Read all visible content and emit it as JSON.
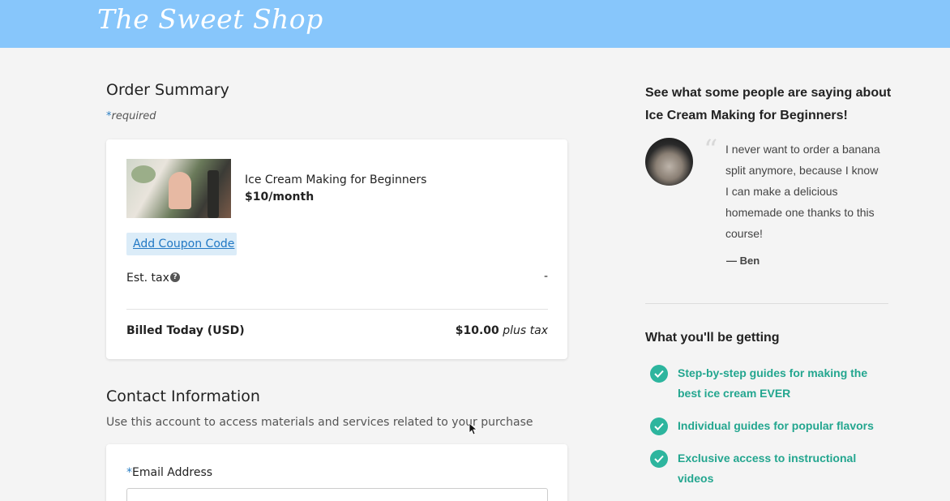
{
  "header": {
    "logo_text": "The Sweet Shop",
    "bg_color": "#87c6fb"
  },
  "order_summary": {
    "title": "Order Summary",
    "required_note": "required",
    "product": {
      "name": "Ice Cream Making for Beginners",
      "price": "$10/month",
      "image": "ice-cream-cone-photo"
    },
    "coupon_label": "Add Coupon Code",
    "tax": {
      "label": "Est. tax",
      "value": "-"
    },
    "billed": {
      "label": "Billed Today (USD)",
      "amount": "$10.00",
      "suffix": "plus tax"
    }
  },
  "contact": {
    "title": "Contact Information",
    "description": "Use this account to access materials and services related to your purchase",
    "email_label": "Email Address",
    "email_value": ""
  },
  "sidebar": {
    "testimonial_heading": "See what some people are saying about Ice Cream Making for Beginners!",
    "quote": "I never want to order a banana split anymore, because I know I can make a delicious homemade one thanks to this course!",
    "author": "— Ben",
    "benefits_heading": "What you'll be getting",
    "benefits": [
      "Step-by-step guides for making the best ice cream EVER",
      "Individual guides for popular flavors",
      "Exclusive access to instructional videos"
    ],
    "accent_color": "#23a68f"
  }
}
